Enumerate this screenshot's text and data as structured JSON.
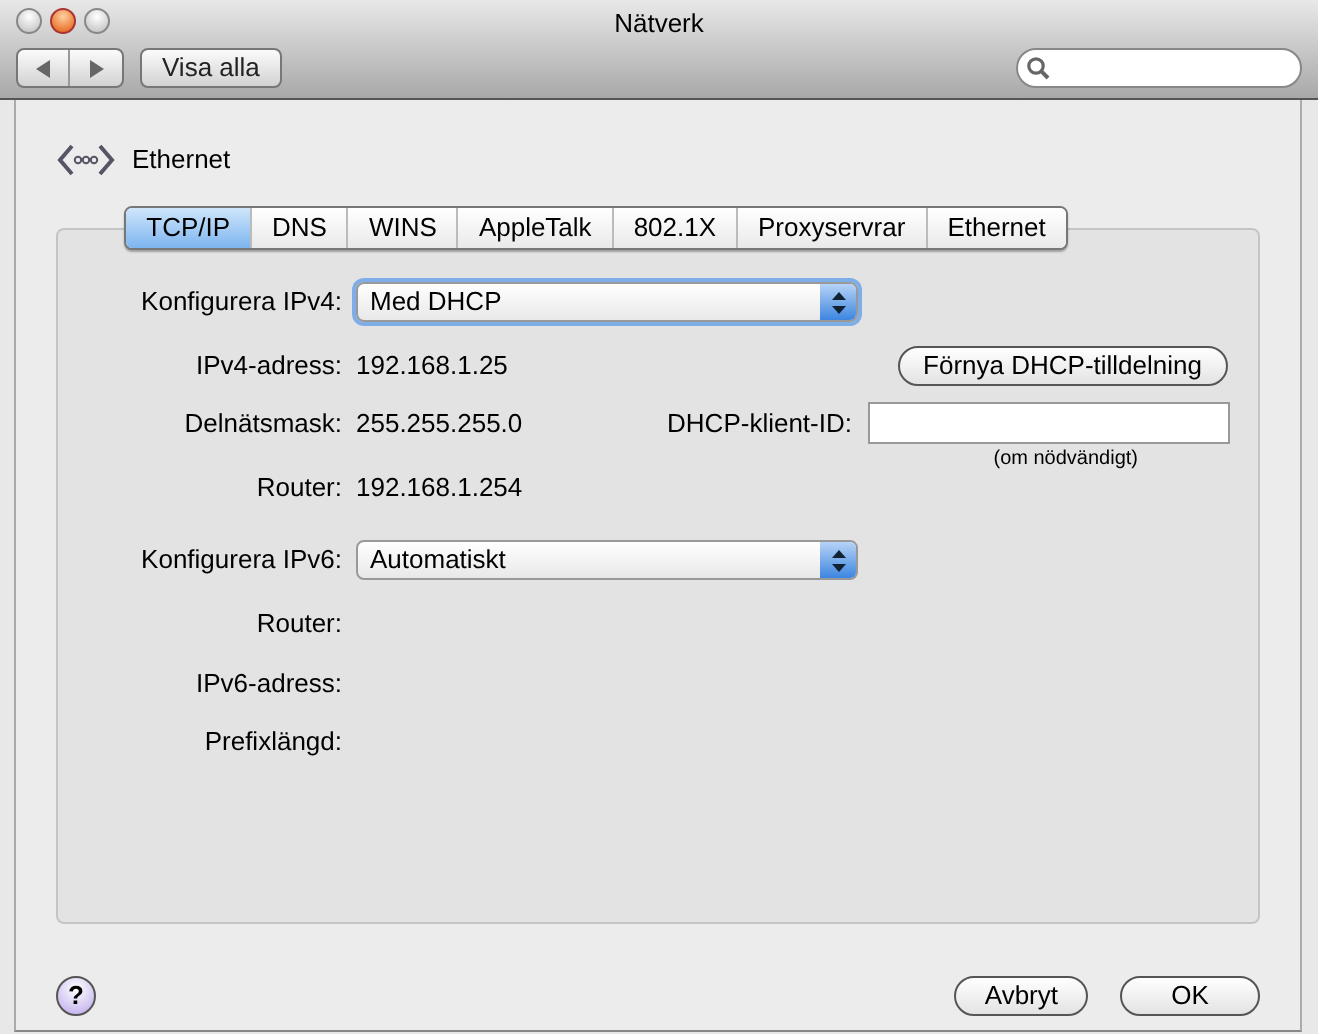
{
  "window": {
    "title": "Nätverk"
  },
  "toolbar": {
    "show_all": "Visa alla"
  },
  "header": {
    "service": "Ethernet"
  },
  "tabs": [
    {
      "label": "TCP/IP",
      "selected": true
    },
    {
      "label": "DNS",
      "selected": false
    },
    {
      "label": "WINS",
      "selected": false
    },
    {
      "label": "AppleTalk",
      "selected": false
    },
    {
      "label": "802.1X",
      "selected": false
    },
    {
      "label": "Proxyservrar",
      "selected": false
    },
    {
      "label": "Ethernet",
      "selected": false
    }
  ],
  "form": {
    "ipv4_config": {
      "label": "Konfigurera IPv4:",
      "value": "Med DHCP",
      "focused": true
    },
    "ipv4_address": {
      "label": "IPv4-adress:",
      "value": "192.168.1.25"
    },
    "renew_button": "Förnya DHCP-tilldelning",
    "subnet_mask": {
      "label": "Delnätsmask:",
      "value": "255.255.255.0"
    },
    "dhcp_client_id": {
      "label": "DHCP-klient-ID:",
      "hint": "(om nödvändigt)"
    },
    "router": {
      "label": "Router:",
      "value": "192.168.1.254"
    },
    "ipv6_config": {
      "label": "Konfigurera IPv6:",
      "value": "Automatiskt",
      "focused": false
    },
    "ipv6_fields": [
      {
        "label": "Router:"
      },
      {
        "label": "IPv6-adress:"
      },
      {
        "label": "Prefixlängd:"
      }
    ]
  },
  "buttons": {
    "help": "?",
    "cancel": "Avbryt",
    "ok": "OK"
  }
}
